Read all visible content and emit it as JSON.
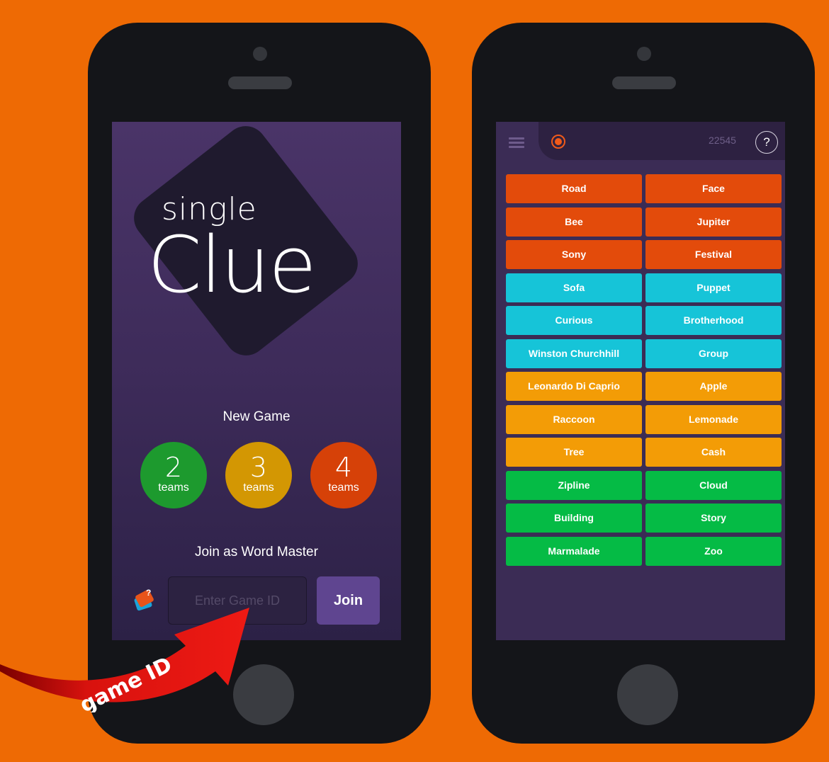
{
  "left_screen": {
    "logo": {
      "line1": "single",
      "line2": "Clue"
    },
    "new_game_label": "New Game",
    "team_buttons": [
      {
        "number": "2",
        "label": "teams",
        "color": "#1d9a2e"
      },
      {
        "number": "3",
        "label": "teams",
        "color": "#d39703"
      },
      {
        "number": "4",
        "label": "teams",
        "color": "#d64108"
      }
    ],
    "join_label": "Join as Word Master",
    "game_id_placeholder": "Enter Game ID",
    "join_button": "Join"
  },
  "right_screen": {
    "game_code": "22545",
    "help_label": "?",
    "words": [
      {
        "text": "Road",
        "color": "#E34B0B"
      },
      {
        "text": "Face",
        "color": "#E34B0B"
      },
      {
        "text": "Bee",
        "color": "#E34B0B"
      },
      {
        "text": "Jupiter",
        "color": "#E34B0B"
      },
      {
        "text": "Sony",
        "color": "#E34B0B"
      },
      {
        "text": "Festival",
        "color": "#E34B0B"
      },
      {
        "text": "Sofa",
        "color": "#16C4D8"
      },
      {
        "text": "Puppet",
        "color": "#16C4D8"
      },
      {
        "text": "Curious",
        "color": "#16C4D8"
      },
      {
        "text": "Brotherhood",
        "color": "#16C4D8"
      },
      {
        "text": "Winston Churchhill",
        "color": "#16C4D8"
      },
      {
        "text": "Group",
        "color": "#16C4D8"
      },
      {
        "text": "Leonardo Di Caprio",
        "color": "#F39C06"
      },
      {
        "text": "Apple",
        "color": "#F39C06"
      },
      {
        "text": "Raccoon",
        "color": "#F39C06"
      },
      {
        "text": "Lemonade",
        "color": "#F39C06"
      },
      {
        "text": "Tree",
        "color": "#F39C06"
      },
      {
        "text": "Cash",
        "color": "#F39C06"
      },
      {
        "text": "Zipline",
        "color": "#05BB45"
      },
      {
        "text": "Cloud",
        "color": "#05BB45"
      },
      {
        "text": "Building",
        "color": "#05BB45"
      },
      {
        "text": "Story",
        "color": "#05BB45"
      },
      {
        "text": "Marmalade",
        "color": "#05BB45"
      },
      {
        "text": "Zoo",
        "color": "#05BB45"
      }
    ]
  },
  "arrow_label": "game ID",
  "colors": {
    "background": "#EE6A04",
    "arrow": "#D8120E"
  }
}
